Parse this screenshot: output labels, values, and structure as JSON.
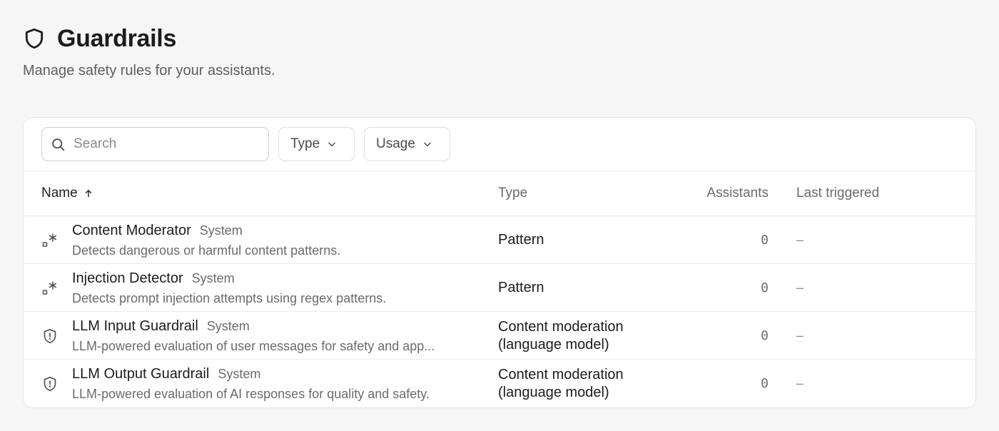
{
  "header": {
    "title": "Guardrails",
    "subtitle": "Manage safety rules for your assistants.",
    "icon": "shield-icon"
  },
  "toolbar": {
    "search_placeholder": "Search",
    "search_value": "",
    "type_filter_label": "Type",
    "usage_filter_label": "Usage"
  },
  "table": {
    "columns": {
      "name": "Name",
      "type": "Type",
      "assistants": "Assistants",
      "last_triggered": "Last triggered"
    },
    "sort": {
      "column": "name",
      "direction": "ascending"
    },
    "rows": [
      {
        "name": "Content Moderator",
        "badge": "System",
        "description": "Detects dangerous or harmful content patterns.",
        "type_line1": "Pattern",
        "type_line2": "",
        "assistants": "0",
        "last_triggered": "–",
        "icon": "regex-icon"
      },
      {
        "name": "Injection Detector",
        "badge": "System",
        "description": "Detects prompt injection attempts using regex patterns.",
        "type_line1": "Pattern",
        "type_line2": "",
        "assistants": "0",
        "last_triggered": "–",
        "icon": "regex-icon"
      },
      {
        "name": "LLM Input Guardrail",
        "badge": "System",
        "description": "LLM-powered evaluation of user messages for safety and app...",
        "type_line1": "Content moderation",
        "type_line2": "(language model)",
        "assistants": "0",
        "last_triggered": "–",
        "icon": "shield-alert-icon"
      },
      {
        "name": "LLM Output Guardrail",
        "badge": "System",
        "description": "LLM-powered evaluation of AI responses for quality and safety.",
        "type_line1": "Content moderation",
        "type_line2": "(language model)",
        "assistants": "0",
        "last_triggered": "–",
        "icon": "shield-alert-icon"
      }
    ]
  },
  "colors": {
    "background": "#f6f6f6",
    "card": "#ffffff",
    "text_primary": "#1c1c1c",
    "text_secondary": "#6b6b6b",
    "border": "#ececec"
  }
}
